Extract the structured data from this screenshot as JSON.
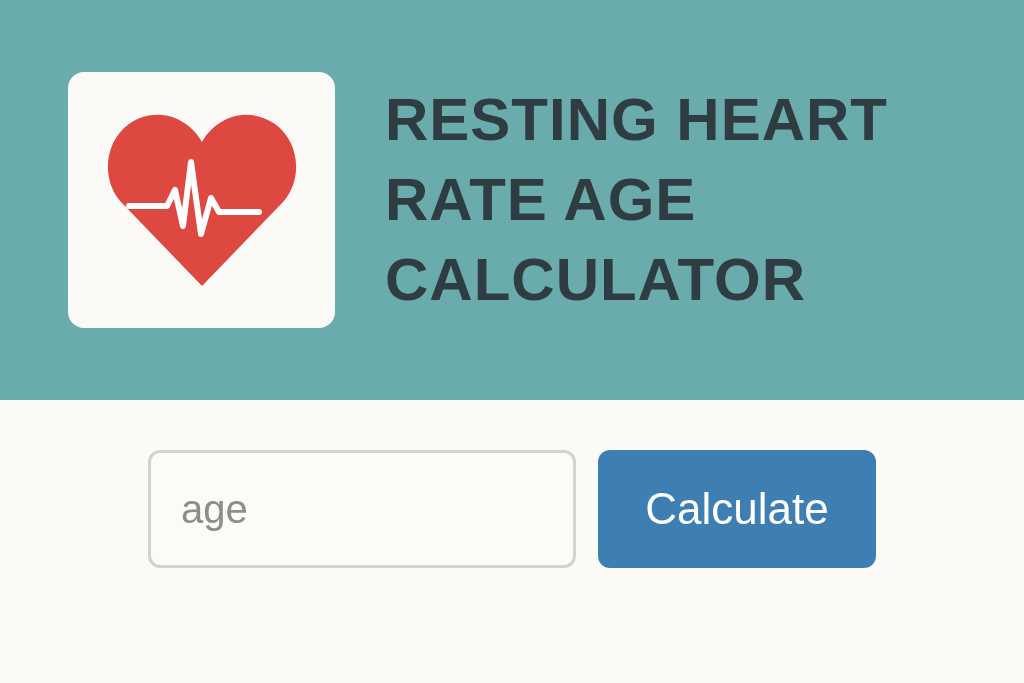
{
  "header": {
    "title": "RESTING HEART RATE AGE CALCULATOR"
  },
  "form": {
    "age_field": {
      "placeholder": "age"
    },
    "button": "Calculate"
  }
}
